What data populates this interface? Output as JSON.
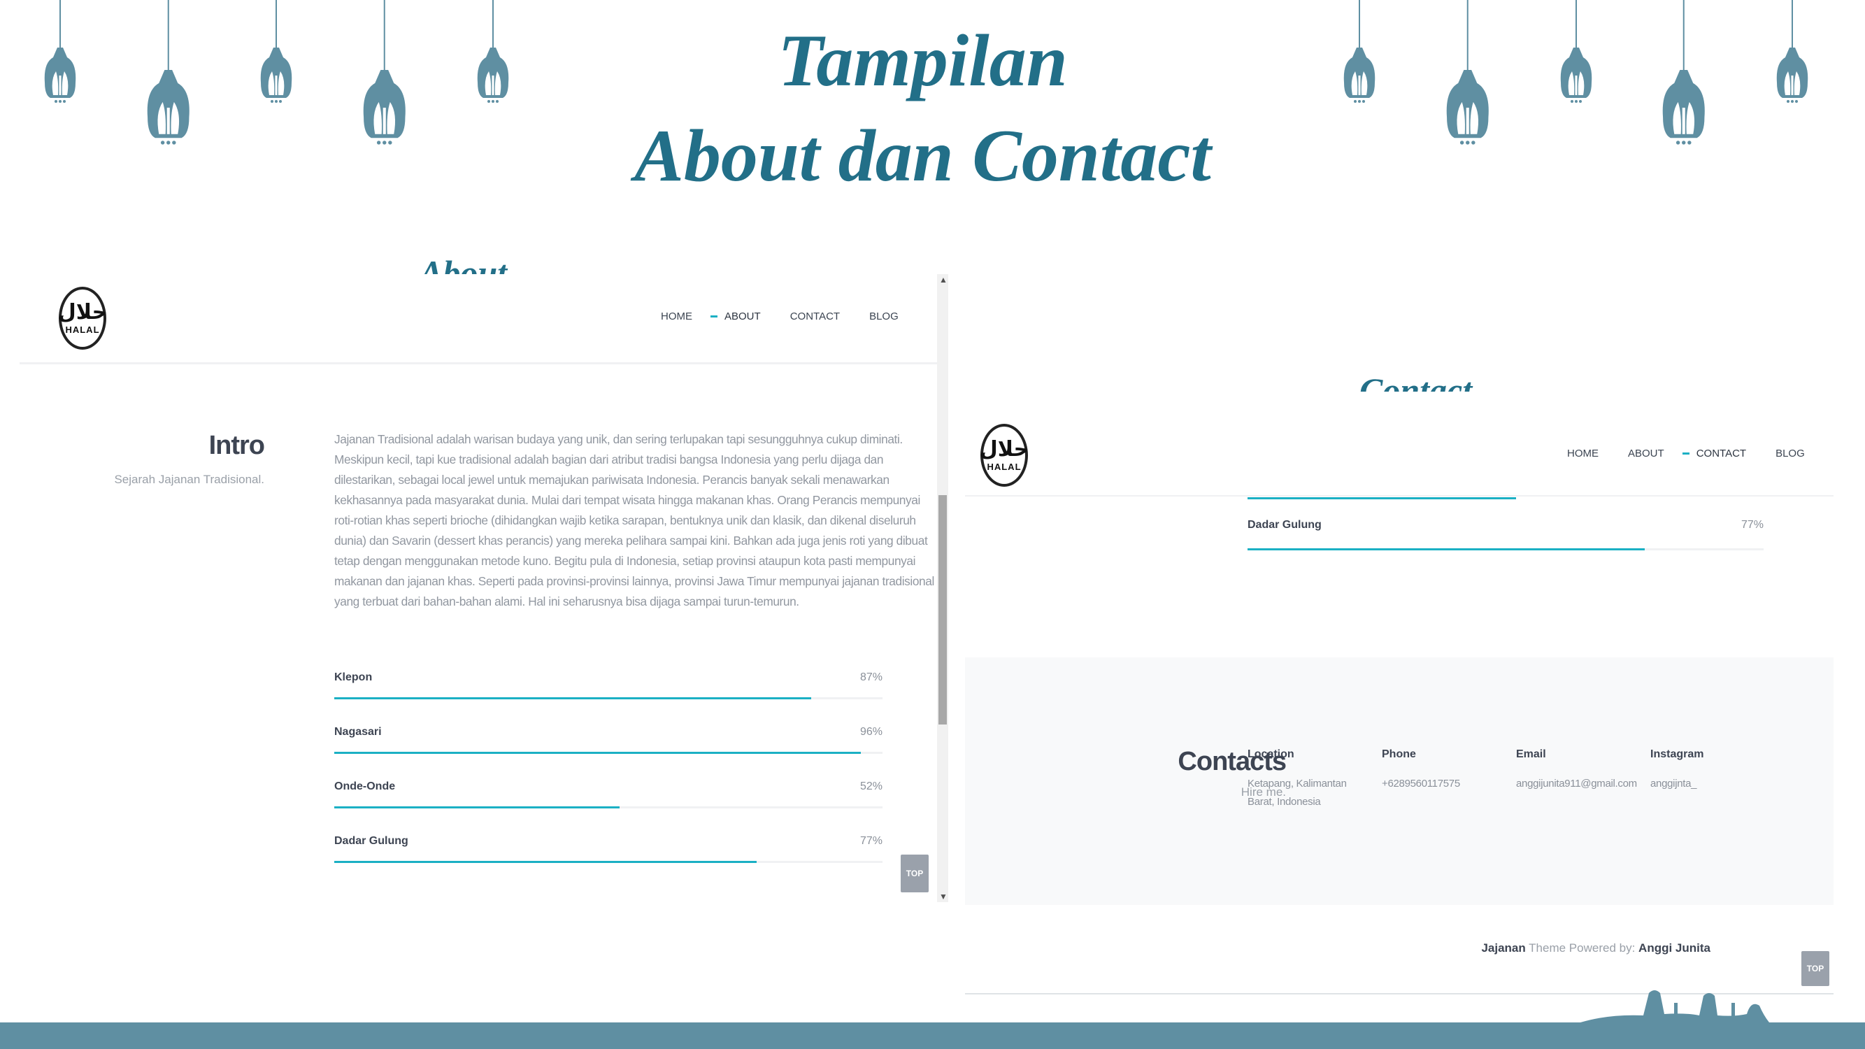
{
  "slide": {
    "title_line1": "Tampilan",
    "title_line2": "About dan Contact",
    "about_label": "About",
    "contact_label": "Contact"
  },
  "colors": {
    "title": "#226f88",
    "lantern": "#5f8fa2",
    "accent": "#1bb0c4",
    "band": "#5f8fa2"
  },
  "about_page": {
    "logo": {
      "arabic": "حلال",
      "text": "HALAL"
    },
    "nav": [
      {
        "label": "HOME",
        "active": false
      },
      {
        "label": "ABOUT",
        "active": true
      },
      {
        "label": "CONTACT",
        "active": false
      },
      {
        "label": "BLOG",
        "active": false
      }
    ],
    "intro": {
      "title": "Intro",
      "subtitle": "Sejarah Jajanan Tradisional.",
      "lines": [
        "Jajanan Tradisional adalah warisan budaya yang unik, dan sering terlupakan tapi sesungguhnya cukup diminati.",
        "Meskipun kecil, tapi kue tradisional adalah bagian dari atribut tradisi bangsa Indonesia yang perlu dijaga dan",
        "dilestarikan, sebagai local jewel untuk memajukan pariwisata Indonesia. Perancis banyak sekali menawarkan",
        "kekhasannya pada masyarakat dunia. Mulai dari tempat wisata hingga makanan khas. Orang Perancis mempunyai",
        "roti-rotian khas seperti brioche (dihidangkan wajib ketika sarapan, bentuknya unik dan klasik, dan dikenal diseluruh",
        "dunia) dan Savarin (dessert khas perancis) yang mereka pelihara sampai kini. Bahkan ada juga jenis roti yang dibuat",
        "tetap dengan menggunakan metode kuno. Begitu pula di Indonesia, setiap provinsi ataupun kota pasti mempunyai",
        "makanan dan jajanan khas. Seperti pada provinsi-provinsi lainnya, provinsi Jawa Timur mempunyai jajanan tradisional",
        "yang terbuat dari bahan-bahan alami. Hal ini seharusnya bisa dijaga sampai turun-temurun."
      ]
    },
    "skills": [
      {
        "name": "Klepon",
        "pct_label": "87%",
        "value": 0.87
      },
      {
        "name": "Nagasari",
        "pct_label": "96%",
        "value": 0.96
      },
      {
        "name": "Onde-Onde",
        "pct_label": "52%",
        "value": 0.52
      },
      {
        "name": "Dadar Gulung",
        "pct_label": "77%",
        "value": 0.77
      }
    ],
    "top_button": "TOP"
  },
  "contact_page": {
    "logo": {
      "arabic": "حلال",
      "text": "HALAL"
    },
    "nav": [
      {
        "label": "HOME",
        "active": false
      },
      {
        "label": "ABOUT",
        "active": false
      },
      {
        "label": "CONTACT",
        "active": true
      },
      {
        "label": "BLOG",
        "active": false
      }
    ],
    "skill": {
      "name": "Dadar Gulung",
      "pct_label": "77%",
      "value": 0.77
    },
    "contacts": {
      "title": "Contacts",
      "subtitle": "Hire me.",
      "columns": [
        {
          "label": "Location",
          "value": "Ketapang, Kalimantan Barat, Indonesia"
        },
        {
          "label": "Phone",
          "value": "+6289560117575"
        },
        {
          "label": "Email",
          "value": "anggijunita911@gmail.com"
        },
        {
          "label": "Instagram",
          "value": "anggijnta_"
        }
      ]
    },
    "footer": {
      "brand": "Jajanan",
      "middle": "Theme Powered by:",
      "author": "Anggi Junita"
    },
    "top_button": "TOP"
  }
}
